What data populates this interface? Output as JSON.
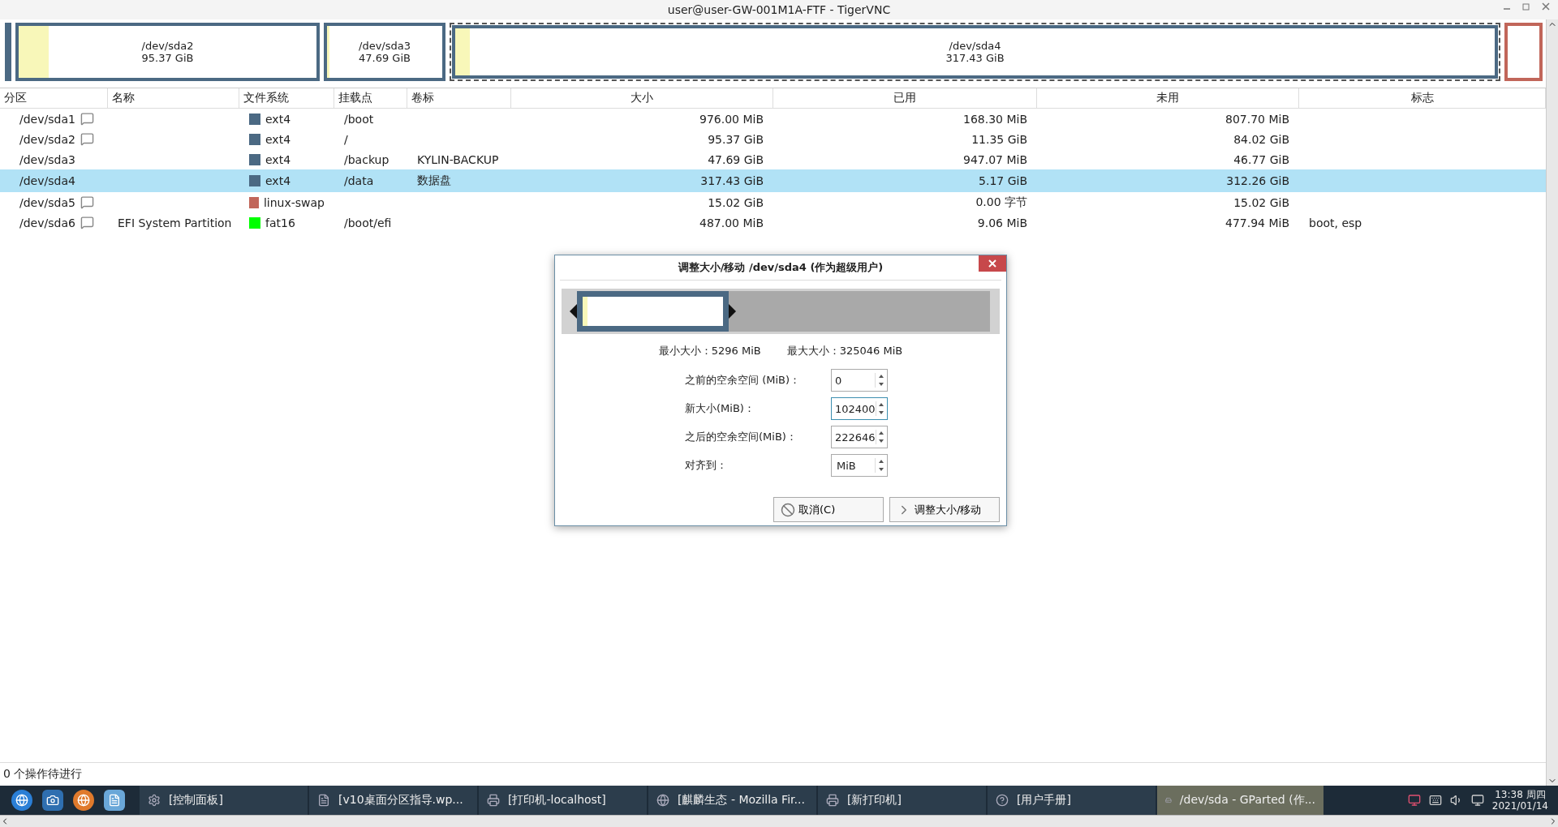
{
  "window": {
    "title": "user@user-GW-001M1A-FTF - TigerVNC"
  },
  "disk_map": [
    {
      "color": "#4b6983",
      "selected": false
    },
    {
      "color": "#4b6983",
      "level": 0.1,
      "selected": false,
      "label": "/dev/sda2",
      "size": "95.37 GiB"
    },
    {
      "color": "#4b6983",
      "level": 0.02,
      "selected": false,
      "label": "/dev/sda3",
      "size": "47.69 GiB"
    },
    {
      "color": "#4b6983",
      "level": 0.014,
      "selected": true,
      "label": "/dev/sda4",
      "size": "317.43 GiB"
    },
    {
      "color": "#c1665a",
      "selected": false
    }
  ],
  "table": {
    "columns": [
      "分区",
      "名称",
      "文件系统",
      "挂载点",
      "卷标",
      "大小",
      "已用",
      "未用",
      "标志"
    ],
    "rows": [
      {
        "partition": "/dev/sda1",
        "locked": true,
        "fs": "ext4",
        "color": "#4b6983",
        "mount": "/boot",
        "size": "976.00 MiB",
        "used": "168.30 MiB",
        "unused": "807.70 MiB",
        "selected": false
      },
      {
        "partition": "/dev/sda2",
        "locked": true,
        "fs": "ext4",
        "color": "#4b6983",
        "mount": "/",
        "size": "95.37 GiB",
        "used": "11.35 GiB",
        "unused": "84.02 GiB",
        "selected": false
      },
      {
        "partition": "/dev/sda3",
        "locked": false,
        "fs": "ext4",
        "color": "#4b6983",
        "mount": "/backup",
        "label": "KYLIN-BACKUP",
        "size": "47.69 GiB",
        "used": "947.07 MiB",
        "unused": "46.77 GiB",
        "selected": false
      },
      {
        "partition": "/dev/sda4",
        "locked": false,
        "fs": "ext4",
        "color": "#4b6983",
        "mount": "/data",
        "label": "数据盘",
        "size": "317.43 GiB",
        "used": "5.17 GiB",
        "unused": "312.26 GiB",
        "selected": true
      },
      {
        "partition": "/dev/sda5",
        "locked": true,
        "fs": "linux-swap",
        "color": "#c1665a",
        "size": "15.02 GiB",
        "used": "0.00 字节",
        "unused": "15.02 GiB",
        "selected": false
      },
      {
        "partition": "/dev/sda6",
        "locked": true,
        "name": "EFI System Partition",
        "fs": "fat16",
        "color": "#00ff00",
        "mount": "/boot/efi",
        "size": "487.00 MiB",
        "used": "9.06 MiB",
        "unused": "477.94 MiB",
        "flags": "boot, esp",
        "selected": false
      }
    ]
  },
  "dialog": {
    "title": "调整大小/移动 /dev/sda4 (作为超级用户)",
    "min_size": "最小大小：5296 MiB",
    "max_size": "最大大小：325046 MiB",
    "fields": [
      {
        "label": "之前的空余空间 (MiB)：",
        "value": "0",
        "kind": "spin"
      },
      {
        "label": "新大小(MiB)：",
        "value": "102400",
        "kind": "spin"
      },
      {
        "label": "之后的空余空间(MiB)：",
        "value": "222646",
        "kind": "spin"
      },
      {
        "label": "对齐到：",
        "value": "MiB",
        "kind": "combo"
      }
    ],
    "cancel": "取消(C)",
    "ok": "调整大小/移动"
  },
  "status_bar": "0 个操作待进行",
  "taskbar": {
    "tasks": [
      {
        "label": "[控制面板]",
        "selected": false
      },
      {
        "label": "[v10桌面分区指导.wp...",
        "selected": false
      },
      {
        "label": "[打印机-localhost]",
        "selected": false
      },
      {
        "label": "[麒麟生态 - Mozilla Fir...",
        "selected": false
      },
      {
        "label": "[新打印机]",
        "selected": false
      },
      {
        "label": "[用户手册]",
        "selected": false
      },
      {
        "label": "/dev/sda - GParted (作...",
        "selected": true
      }
    ],
    "time": "13:38 周四",
    "date": "2021/01/14"
  }
}
